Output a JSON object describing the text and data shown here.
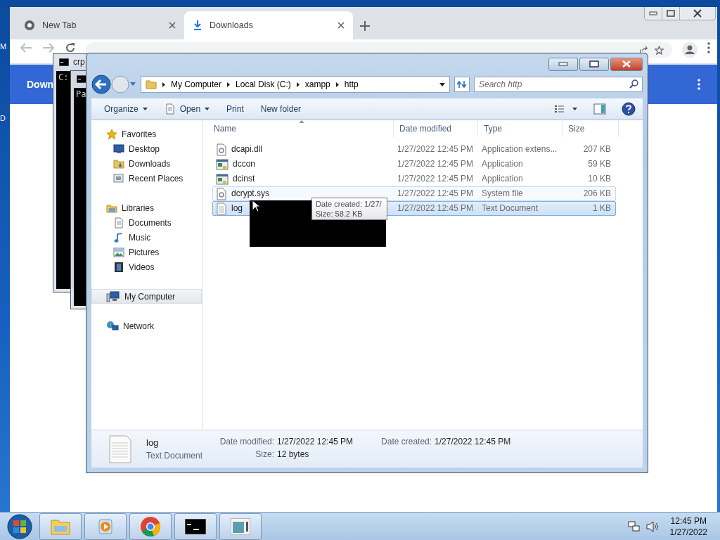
{
  "desktop": {
    "icon_labels": [
      "M",
      "D"
    ]
  },
  "browser": {
    "tabs": [
      {
        "title": "New Tab",
        "selected": false
      },
      {
        "title": "Downloads",
        "selected": true
      }
    ],
    "page_title": "Down"
  },
  "consoles": [
    {
      "title": "crp",
      "text": "C:"
    },
    {
      "text": "Pa"
    }
  ],
  "explorer": {
    "breadcrumb": [
      "My Computer",
      "Local Disk (C:)",
      "xampp",
      "http"
    ],
    "search": {
      "placeholder": "Search http"
    },
    "toolbar": [
      {
        "label": "Organize",
        "dropdown": true
      },
      {
        "label": "Open",
        "dropdown": true
      },
      {
        "label": "Print",
        "dropdown": false
      },
      {
        "label": "New folder",
        "dropdown": false
      }
    ],
    "nav": [
      {
        "label": "Favorites",
        "selected": false,
        "children": [
          {
            "label": "Desktop",
            "selected": false
          },
          {
            "label": "Downloads",
            "selected": false
          },
          {
            "label": "Recent Places",
            "selected": false
          }
        ]
      },
      {
        "label": "Libraries",
        "selected": false,
        "children": [
          {
            "label": "Documents",
            "selected": false
          },
          {
            "label": "Music",
            "selected": false
          },
          {
            "label": "Pictures",
            "selected": false
          },
          {
            "label": "Videos",
            "selected": false
          }
        ]
      },
      {
        "label": "My Computer",
        "selected": true
      },
      {
        "label": "Network",
        "selected": false
      }
    ],
    "columns": [
      "Name",
      "Date modified",
      "Type",
      "Size"
    ],
    "files": [
      {
        "name": "dcapi.dll",
        "date": "1/27/2022 12:45 PM",
        "type": "Application extens...",
        "size": "207 KB",
        "kind": "library",
        "selected": false,
        "hovered": false
      },
      {
        "name": "dccon",
        "date": "1/27/2022 12:45 PM",
        "type": "Application",
        "size": "59 KB",
        "kind": "application",
        "selected": false,
        "hovered": false
      },
      {
        "name": "dcinst",
        "date": "1/27/2022 12:45 PM",
        "type": "Application",
        "size": "10 KB",
        "kind": "application",
        "selected": false,
        "hovered": false
      },
      {
        "name": "dcrypt.sys",
        "date": "1/27/2022 12:45 PM",
        "type": "System file",
        "size": "206 KB",
        "kind": "library",
        "selected": false,
        "hovered": true
      },
      {
        "name": "log",
        "date": "1/27/2022 12:45 PM",
        "type": "Text Document",
        "size": "1 KB",
        "kind": "text",
        "selected": true,
        "hovered": false
      }
    ],
    "tooltip": [
      "Date created: 1/27/",
      "Size: 58.2 KB"
    ],
    "details": {
      "name": "log",
      "type": "Text Document",
      "fields": [
        {
          "label": "Date modified:",
          "value": "1/27/2022 12:45 PM"
        },
        {
          "label": "Size:",
          "value": "12 bytes"
        },
        {
          "label": "Date created:",
          "value": "1/27/2022 12:45 PM"
        }
      ]
    }
  },
  "taskbar": {
    "time": "12:45 PM",
    "date": "1/27/2022"
  }
}
